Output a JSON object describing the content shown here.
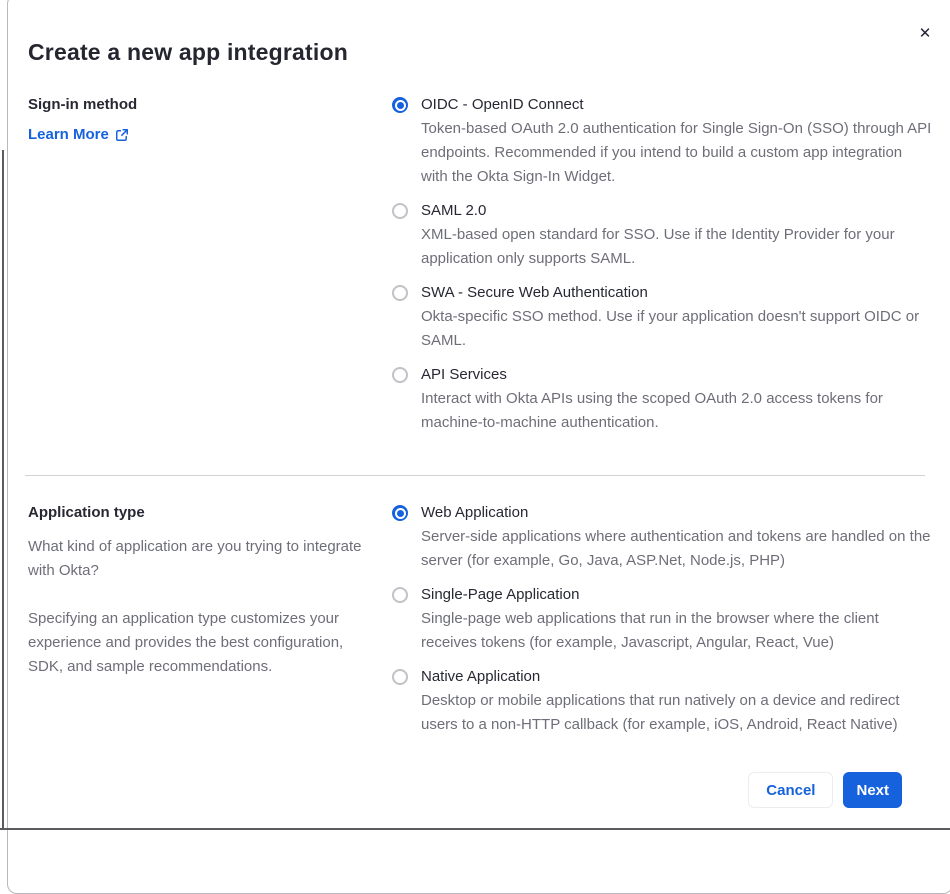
{
  "modal": {
    "title": "Create a new app integration",
    "close_icon": "✕"
  },
  "signin_section": {
    "heading": "Sign-in method",
    "learn_more_label": "Learn More",
    "options": [
      {
        "label": "OIDC - OpenID Connect",
        "description": "Token-based OAuth 2.0 authentication for Single Sign-On (SSO) through API endpoints. Recommended if you intend to build a custom app integration with the Okta Sign-In Widget.",
        "selected": true
      },
      {
        "label": "SAML 2.0",
        "description": "XML-based open standard for SSO. Use if the Identity Provider for your application only supports SAML.",
        "selected": false
      },
      {
        "label": "SWA - Secure Web Authentication",
        "description": "Okta-specific SSO method. Use if your application doesn't support OIDC or SAML.",
        "selected": false
      },
      {
        "label": "API Services",
        "description": "Interact with Okta APIs using the scoped OAuth 2.0 access tokens for machine-to-machine authentication.",
        "selected": false
      }
    ]
  },
  "apptype_section": {
    "heading": "Application type",
    "paragraph1": "What kind of application are you trying to integrate with Okta?",
    "paragraph2": "Specifying an application type customizes your experience and provides the best configuration, SDK, and sample recommendations.",
    "options": [
      {
        "label": "Web Application",
        "description": "Server-side applications where authentication and tokens are handled on the server (for example, Go, Java, ASP.Net, Node.js, PHP)",
        "selected": true
      },
      {
        "label": "Single-Page Application",
        "description": "Single-page web applications that run in the browser where the client receives tokens (for example, Javascript, Angular, React, Vue)",
        "selected": false
      },
      {
        "label": "Native Application",
        "description": "Desktop or mobile applications that run natively on a device and redirect users to a non-HTTP callback (for example, iOS, Android, React Native)",
        "selected": false
      }
    ]
  },
  "footer": {
    "cancel_label": "Cancel",
    "next_label": "Next"
  },
  "colors": {
    "accent_blue": "#1662dd",
    "text_dark": "#272833",
    "text_gray": "#6e6e78",
    "divider": "#d2d2d7",
    "radio_border": "#c1c1c8"
  }
}
